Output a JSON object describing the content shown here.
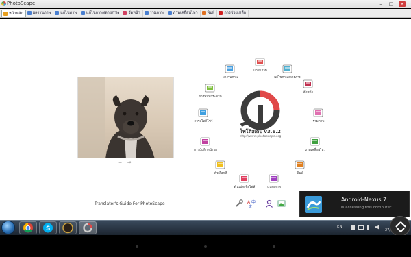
{
  "window": {
    "title": "PhotoScape",
    "minimize": "–",
    "maximize": "□",
    "close": "✕"
  },
  "tabs": [
    {
      "label": "หน้าหลัก",
      "icon": "home-icon",
      "color": "#e8a020",
      "active": true
    },
    {
      "label": "ผลงานภาพ",
      "icon": "photo-viewer-icon",
      "color": "#4a7fd0",
      "active": false
    },
    {
      "label": "แก้ไขภาพ",
      "icon": "editor-icon",
      "color": "#4a7fd0",
      "active": false
    },
    {
      "label": "แก้ไขภาพหลายภาพ",
      "icon": "batch-editor-icon",
      "color": "#4a7fd0",
      "active": false
    },
    {
      "label": "จัดหน้า",
      "icon": "page-icon",
      "color": "#d04060",
      "active": false
    },
    {
      "label": "รวมภาพ",
      "icon": "combine-icon",
      "color": "#4a7fd0",
      "active": false
    },
    {
      "label": "ภาพเคลื่อนไหว",
      "icon": "gif-icon",
      "color": "#4a7fd0",
      "active": false
    },
    {
      "label": "พิมพ์",
      "icon": "print-icon",
      "color": "#e07020",
      "active": false
    },
    {
      "label": "การช่วยเหลือ",
      "icon": "help-icon",
      "color": "#d02020",
      "active": false
    }
  ],
  "ring": [
    {
      "label": "ผลงานภาพ",
      "icon": "photo-viewer-icon",
      "color": "#4aa0e0"
    },
    {
      "label": "แก้ไขภาพ",
      "icon": "editor-icon",
      "color": "#e05050"
    },
    {
      "label": "แก้ไขภาพหลายภาพ",
      "icon": "batch-editor-icon",
      "color": "#50b0d0"
    },
    {
      "label": "จัดหน้า",
      "icon": "page-icon",
      "color": "#c03050"
    },
    {
      "label": "รวมภาพ",
      "icon": "combine-icon",
      "color": "#e070b0"
    },
    {
      "label": "ภาพเคลื่อนไหว",
      "icon": "gif-icon",
      "color": "#40a040"
    },
    {
      "label": "พิมพ์",
      "icon": "print-icon",
      "color": "#e08020"
    },
    {
      "label": "แปลงภาพ",
      "icon": "raw-converter-icon",
      "color": "#a040c0"
    },
    {
      "label": "ตัวแปลงชื่อไฟล์",
      "icon": "rename-icon",
      "color": "#e04060"
    },
    {
      "label": "ตัวเลือกสี",
      "icon": "color-picker-icon",
      "color": "#f0c020"
    },
    {
      "label": "การบันทึกหน้าจอ",
      "icon": "screen-capture-icon",
      "color": "#c040a0"
    },
    {
      "label": "การสไลด์โชว์",
      "icon": "slideshow-icon",
      "color": "#40a0e0"
    },
    {
      "label": "การพิมพ์กระดาษ",
      "icon": "paper-print-icon",
      "color": "#80c040"
    }
  ],
  "logo": {
    "title": "โฟโต้สเคป v3.6.2",
    "subtitle": "http://www.photoscape.org"
  },
  "nav_arrows": "⇦ ⇨",
  "guide_link": "Translator's Guide For PhotoScape",
  "toast": {
    "title": "Android-Nexus 7",
    "message": "is accessing this computer"
  },
  "tray": {
    "lang": "EN",
    "clock": "27/07"
  }
}
